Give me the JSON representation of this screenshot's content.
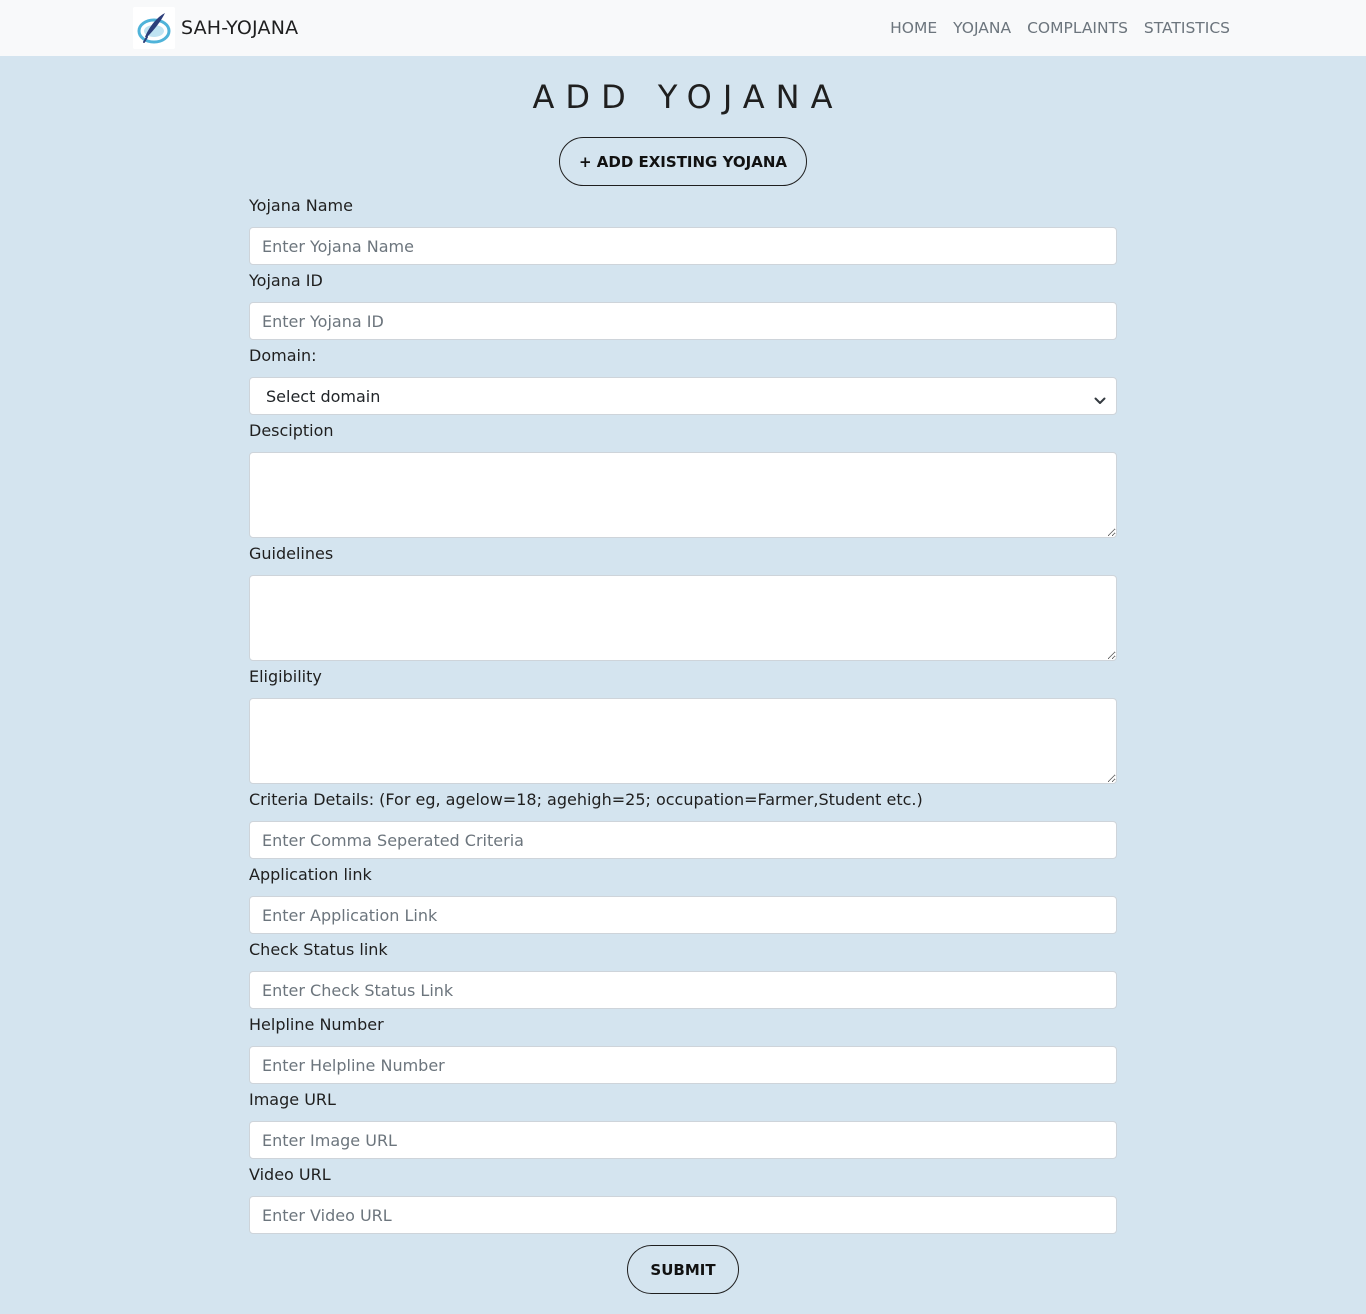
{
  "navbar": {
    "brand": "SAH-YOJANA",
    "logo_icon": "quill-logo-icon",
    "links": [
      "HOME",
      "YOJANA",
      "COMPLAINTS",
      "STATISTICS"
    ]
  },
  "page": {
    "title": "ADD YOJANA",
    "add_existing_label": "+ ADD EXISTING YOJANA",
    "submit_label": "SUBMIT"
  },
  "form": {
    "yojana_name": {
      "label": "Yojana Name",
      "placeholder": "Enter Yojana Name",
      "value": ""
    },
    "yojana_id": {
      "label": "Yojana ID",
      "placeholder": "Enter Yojana ID",
      "value": ""
    },
    "domain": {
      "label": "Domain:",
      "selected": "Select domain"
    },
    "description": {
      "label": "Desciption",
      "value": ""
    },
    "guidelines": {
      "label": "Guidelines",
      "value": ""
    },
    "eligibility": {
      "label": "Eligibility",
      "value": ""
    },
    "criteria": {
      "label": "Criteria Details: (For eg, agelow=18; agehigh=25; occupation=Farmer,Student etc.)",
      "placeholder": "Enter Comma Seperated Criteria",
      "value": ""
    },
    "application_link": {
      "label": "Application link",
      "placeholder": "Enter Application Link",
      "value": ""
    },
    "check_status_link": {
      "label": "Check Status link",
      "placeholder": "Enter Check Status Link",
      "value": ""
    },
    "helpline": {
      "label": "Helpline Number",
      "placeholder": "Enter Helpline Number",
      "value": ""
    },
    "image_url": {
      "label": "Image URL",
      "placeholder": "Enter Image URL",
      "value": ""
    },
    "video_url": {
      "label": "Video URL",
      "placeholder": "Enter Video URL",
      "value": ""
    }
  }
}
